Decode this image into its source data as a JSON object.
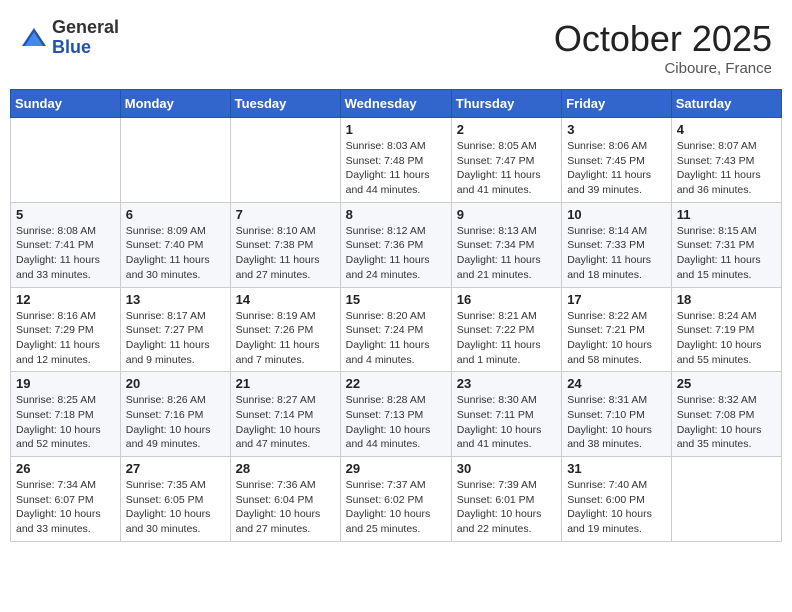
{
  "header": {
    "logo_general": "General",
    "logo_blue": "Blue",
    "month": "October 2025",
    "location": "Ciboure, France"
  },
  "weekdays": [
    "Sunday",
    "Monday",
    "Tuesday",
    "Wednesday",
    "Thursday",
    "Friday",
    "Saturday"
  ],
  "weeks": [
    [
      {
        "day": "",
        "info": ""
      },
      {
        "day": "",
        "info": ""
      },
      {
        "day": "",
        "info": ""
      },
      {
        "day": "1",
        "info": "Sunrise: 8:03 AM\nSunset: 7:48 PM\nDaylight: 11 hours and 44 minutes."
      },
      {
        "day": "2",
        "info": "Sunrise: 8:05 AM\nSunset: 7:47 PM\nDaylight: 11 hours and 41 minutes."
      },
      {
        "day": "3",
        "info": "Sunrise: 8:06 AM\nSunset: 7:45 PM\nDaylight: 11 hours and 39 minutes."
      },
      {
        "day": "4",
        "info": "Sunrise: 8:07 AM\nSunset: 7:43 PM\nDaylight: 11 hours and 36 minutes."
      }
    ],
    [
      {
        "day": "5",
        "info": "Sunrise: 8:08 AM\nSunset: 7:41 PM\nDaylight: 11 hours and 33 minutes."
      },
      {
        "day": "6",
        "info": "Sunrise: 8:09 AM\nSunset: 7:40 PM\nDaylight: 11 hours and 30 minutes."
      },
      {
        "day": "7",
        "info": "Sunrise: 8:10 AM\nSunset: 7:38 PM\nDaylight: 11 hours and 27 minutes."
      },
      {
        "day": "8",
        "info": "Sunrise: 8:12 AM\nSunset: 7:36 PM\nDaylight: 11 hours and 24 minutes."
      },
      {
        "day": "9",
        "info": "Sunrise: 8:13 AM\nSunset: 7:34 PM\nDaylight: 11 hours and 21 minutes."
      },
      {
        "day": "10",
        "info": "Sunrise: 8:14 AM\nSunset: 7:33 PM\nDaylight: 11 hours and 18 minutes."
      },
      {
        "day": "11",
        "info": "Sunrise: 8:15 AM\nSunset: 7:31 PM\nDaylight: 11 hours and 15 minutes."
      }
    ],
    [
      {
        "day": "12",
        "info": "Sunrise: 8:16 AM\nSunset: 7:29 PM\nDaylight: 11 hours and 12 minutes."
      },
      {
        "day": "13",
        "info": "Sunrise: 8:17 AM\nSunset: 7:27 PM\nDaylight: 11 hours and 9 minutes."
      },
      {
        "day": "14",
        "info": "Sunrise: 8:19 AM\nSunset: 7:26 PM\nDaylight: 11 hours and 7 minutes."
      },
      {
        "day": "15",
        "info": "Sunrise: 8:20 AM\nSunset: 7:24 PM\nDaylight: 11 hours and 4 minutes."
      },
      {
        "day": "16",
        "info": "Sunrise: 8:21 AM\nSunset: 7:22 PM\nDaylight: 11 hours and 1 minute."
      },
      {
        "day": "17",
        "info": "Sunrise: 8:22 AM\nSunset: 7:21 PM\nDaylight: 10 hours and 58 minutes."
      },
      {
        "day": "18",
        "info": "Sunrise: 8:24 AM\nSunset: 7:19 PM\nDaylight: 10 hours and 55 minutes."
      }
    ],
    [
      {
        "day": "19",
        "info": "Sunrise: 8:25 AM\nSunset: 7:18 PM\nDaylight: 10 hours and 52 minutes."
      },
      {
        "day": "20",
        "info": "Sunrise: 8:26 AM\nSunset: 7:16 PM\nDaylight: 10 hours and 49 minutes."
      },
      {
        "day": "21",
        "info": "Sunrise: 8:27 AM\nSunset: 7:14 PM\nDaylight: 10 hours and 47 minutes."
      },
      {
        "day": "22",
        "info": "Sunrise: 8:28 AM\nSunset: 7:13 PM\nDaylight: 10 hours and 44 minutes."
      },
      {
        "day": "23",
        "info": "Sunrise: 8:30 AM\nSunset: 7:11 PM\nDaylight: 10 hours and 41 minutes."
      },
      {
        "day": "24",
        "info": "Sunrise: 8:31 AM\nSunset: 7:10 PM\nDaylight: 10 hours and 38 minutes."
      },
      {
        "day": "25",
        "info": "Sunrise: 8:32 AM\nSunset: 7:08 PM\nDaylight: 10 hours and 35 minutes."
      }
    ],
    [
      {
        "day": "26",
        "info": "Sunrise: 7:34 AM\nSunset: 6:07 PM\nDaylight: 10 hours and 33 minutes."
      },
      {
        "day": "27",
        "info": "Sunrise: 7:35 AM\nSunset: 6:05 PM\nDaylight: 10 hours and 30 minutes."
      },
      {
        "day": "28",
        "info": "Sunrise: 7:36 AM\nSunset: 6:04 PM\nDaylight: 10 hours and 27 minutes."
      },
      {
        "day": "29",
        "info": "Sunrise: 7:37 AM\nSunset: 6:02 PM\nDaylight: 10 hours and 25 minutes."
      },
      {
        "day": "30",
        "info": "Sunrise: 7:39 AM\nSunset: 6:01 PM\nDaylight: 10 hours and 22 minutes."
      },
      {
        "day": "31",
        "info": "Sunrise: 7:40 AM\nSunset: 6:00 PM\nDaylight: 10 hours and 19 minutes."
      },
      {
        "day": "",
        "info": ""
      }
    ]
  ]
}
